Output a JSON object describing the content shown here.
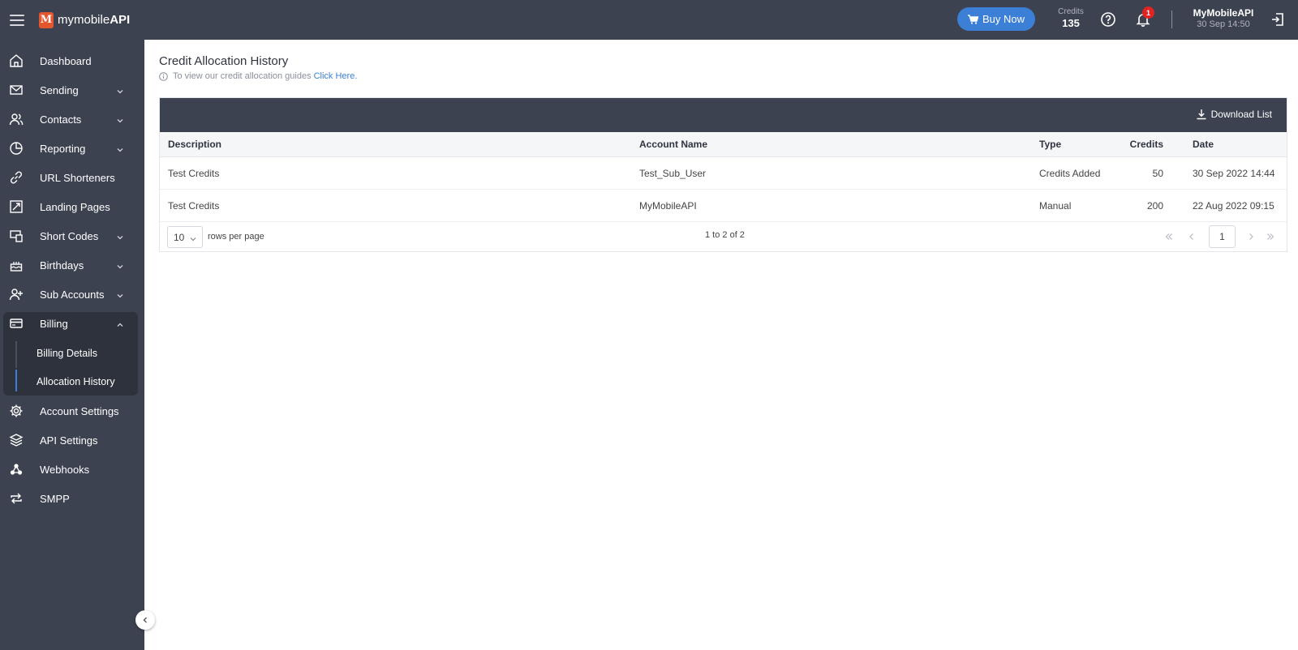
{
  "app": {
    "logo_thin": "mymobile",
    "logo_bold": "API",
    "logo_mark": "M"
  },
  "topbar": {
    "buy_now_label": "Buy Now",
    "credits_label": "Credits",
    "credits_value": "135",
    "notification_count": "1",
    "user_name": "MyMobileAPI",
    "user_datetime": "30 Sep 14:50"
  },
  "sidebar": {
    "items": [
      {
        "label": "Dashboard",
        "icon": "home-icon"
      },
      {
        "label": "Sending",
        "icon": "envelope-icon"
      },
      {
        "label": "Contacts",
        "icon": "contacts-icon"
      },
      {
        "label": "Reporting",
        "icon": "pie-chart-icon"
      },
      {
        "label": "URL Shorteners",
        "icon": "link-icon"
      },
      {
        "label": "Landing Pages",
        "icon": "landing-page-icon"
      },
      {
        "label": "Short Codes",
        "icon": "short-code-icon"
      },
      {
        "label": "Birthdays",
        "icon": "cake-icon"
      },
      {
        "label": "Sub Accounts",
        "icon": "add-user-icon"
      },
      {
        "label": "Billing",
        "icon": "credit-card-icon"
      },
      {
        "label": "Account Settings",
        "icon": "gear-icon"
      },
      {
        "label": "API Settings",
        "icon": "layers-icon"
      },
      {
        "label": "Webhooks",
        "icon": "webhook-icon"
      },
      {
        "label": "SMPP",
        "icon": "repeat-icon"
      }
    ],
    "billing_sub": [
      {
        "label": "Billing Details"
      },
      {
        "label": "Allocation History"
      }
    ]
  },
  "main": {
    "title": "Credit Allocation History",
    "info_text": "To view our credit allocation guides",
    "info_link": "Click Here.",
    "download_label": "Download List",
    "columns": [
      "Description",
      "Account Name",
      "Type",
      "Credits",
      "Date"
    ],
    "rows": [
      {
        "description": "Test Credits",
        "account": "Test_Sub_User",
        "type": "Credits Added",
        "credits": "50",
        "date": "30 Sep 2022 14:44"
      },
      {
        "description": "Test Credits",
        "account": "MyMobileAPI",
        "type": "Manual",
        "credits": "200",
        "date": "22 Aug 2022 09:15"
      }
    ],
    "pagination": {
      "rows_per_page": "10",
      "rows_per_page_label": "rows per page",
      "range_text": "1 to 2 of 2",
      "current_page": "1"
    }
  },
  "colors": {
    "sidebar_bg": "#3d4250",
    "accent": "#3b7fd6",
    "badge": "#e02424"
  }
}
